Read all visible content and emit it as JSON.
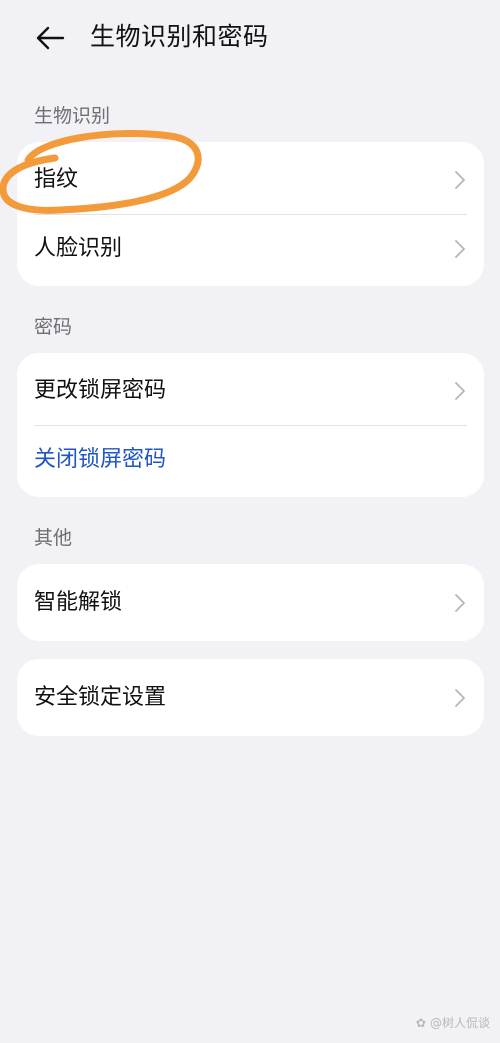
{
  "header": {
    "title": "生物识别和密码"
  },
  "sections": {
    "biometrics": {
      "label": "生物识别",
      "items": [
        {
          "label": "指纹"
        },
        {
          "label": "人脸识别"
        }
      ]
    },
    "password": {
      "label": "密码",
      "items": [
        {
          "label": "更改锁屏密码"
        },
        {
          "label": "关闭锁屏密码"
        }
      ]
    },
    "other": {
      "label": "其他",
      "items": [
        {
          "label": "智能解锁"
        }
      ]
    },
    "security": {
      "items": [
        {
          "label": "安全锁定设置"
        }
      ]
    }
  },
  "watermark": {
    "text": "@树人侃谈"
  },
  "colors": {
    "background": "#f2f1f6",
    "card": "#ffffff",
    "link_blue": "#1f55c4",
    "annotation_orange": "#f39a3a"
  },
  "icons": {
    "back": "arrow-left-icon",
    "chevron": "chevron-right-icon"
  }
}
